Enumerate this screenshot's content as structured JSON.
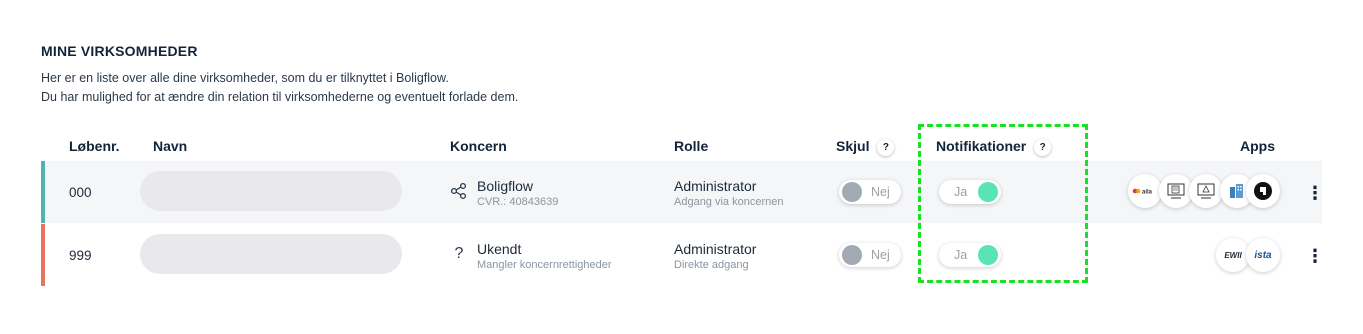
{
  "section": {
    "title": "MINE VIRKSOMHEDER",
    "desc_line1": "Her er en liste over alle dine virksomheder, som du er tilknyttet i Boligflow.",
    "desc_line2": "Du har mulighed for at ændre din relation til virksomhederne og eventuelt forlade dem."
  },
  "columns": {
    "loebenr": "Løbenr.",
    "navn": "Navn",
    "koncern": "Koncern",
    "rolle": "Rolle",
    "skjul": "Skjul",
    "notifikationer": "Notifikationer",
    "apps": "Apps",
    "help": "?"
  },
  "rows": [
    {
      "number": "000",
      "koncern_icon": "share-nodes-icon",
      "koncern_name": "Boligflow",
      "koncern_sub": "CVR.: 40843639",
      "role": "Administrator",
      "role_sub": "Adgang via koncernen",
      "skjul_label": "Nej",
      "skjul_on": false,
      "notif_label": "Ja",
      "notif_on": true,
      "accent": "#4db6ac",
      "apps": [
        "boligflow-app-icon",
        "document-app-icon",
        "monitor-app-icon",
        "building-app-icon",
        "dark-app-icon"
      ]
    },
    {
      "number": "999",
      "koncern_icon": "question-icon",
      "koncern_name": "Ukendt",
      "koncern_sub": "Mangler koncernrettigheder",
      "role": "Administrator",
      "role_sub": "Direkte adgang",
      "skjul_label": "Nej",
      "skjul_on": false,
      "notif_label": "Ja",
      "notif_on": true,
      "accent": "#e8735a",
      "apps": [
        "ewii-app-icon",
        "ista-app-icon"
      ],
      "app_labels": {
        "ewii": "EWII",
        "ista": "ista"
      }
    }
  ],
  "row2_icon_glyph": "?",
  "menu_glyph": "⋮",
  "colors": {
    "toggle_on": "#5ae3b4",
    "toggle_off": "#a1aab3",
    "highlight": "#19e025"
  }
}
